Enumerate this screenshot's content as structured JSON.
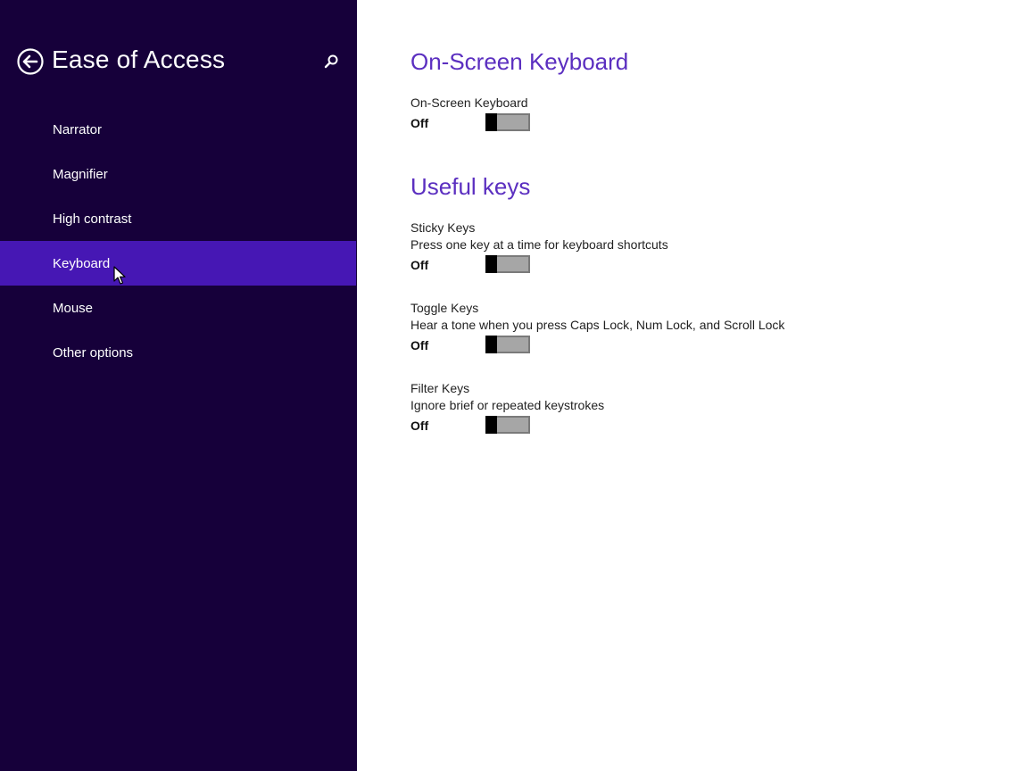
{
  "left_pane": {
    "title": "Ease of Access",
    "back_label": "Back",
    "search_label": "Search",
    "nav_items": [
      {
        "label": "Narrator",
        "selected": false
      },
      {
        "label": "Magnifier",
        "selected": false
      },
      {
        "label": "High contrast",
        "selected": false
      },
      {
        "label": "Keyboard",
        "selected": true
      },
      {
        "label": "Mouse",
        "selected": false
      },
      {
        "label": "Other options",
        "selected": false
      }
    ]
  },
  "right_pane": {
    "on_screen_keyboard": {
      "heading": "On-Screen Keyboard",
      "setting": {
        "title": "On-Screen Keyboard",
        "state": "Off",
        "on": false
      }
    },
    "useful_keys": {
      "heading": "Useful keys",
      "settings": [
        {
          "title": "Sticky Keys",
          "description": "Press one key at a time for keyboard shortcuts",
          "state": "Off",
          "on": false
        },
        {
          "title": "Toggle Keys",
          "description": "Hear a tone when you press Caps Lock, Num Lock, and Scroll Lock",
          "state": "Off",
          "on": false
        },
        {
          "title": "Filter Keys",
          "description": "Ignore brief or repeated keystrokes",
          "state": "Off",
          "on": false
        }
      ]
    }
  },
  "colors": {
    "left_pane_bg": "#16003a",
    "selected_bg": "#4617b4",
    "heading_accent": "#5b2fc0",
    "toggle_track": "#a6a6a6",
    "toggle_thumb": "#000000"
  },
  "icons": {
    "back": "back-arrow-circle-icon",
    "search": "search-icon",
    "cursor": "mouse-pointer-icon"
  }
}
